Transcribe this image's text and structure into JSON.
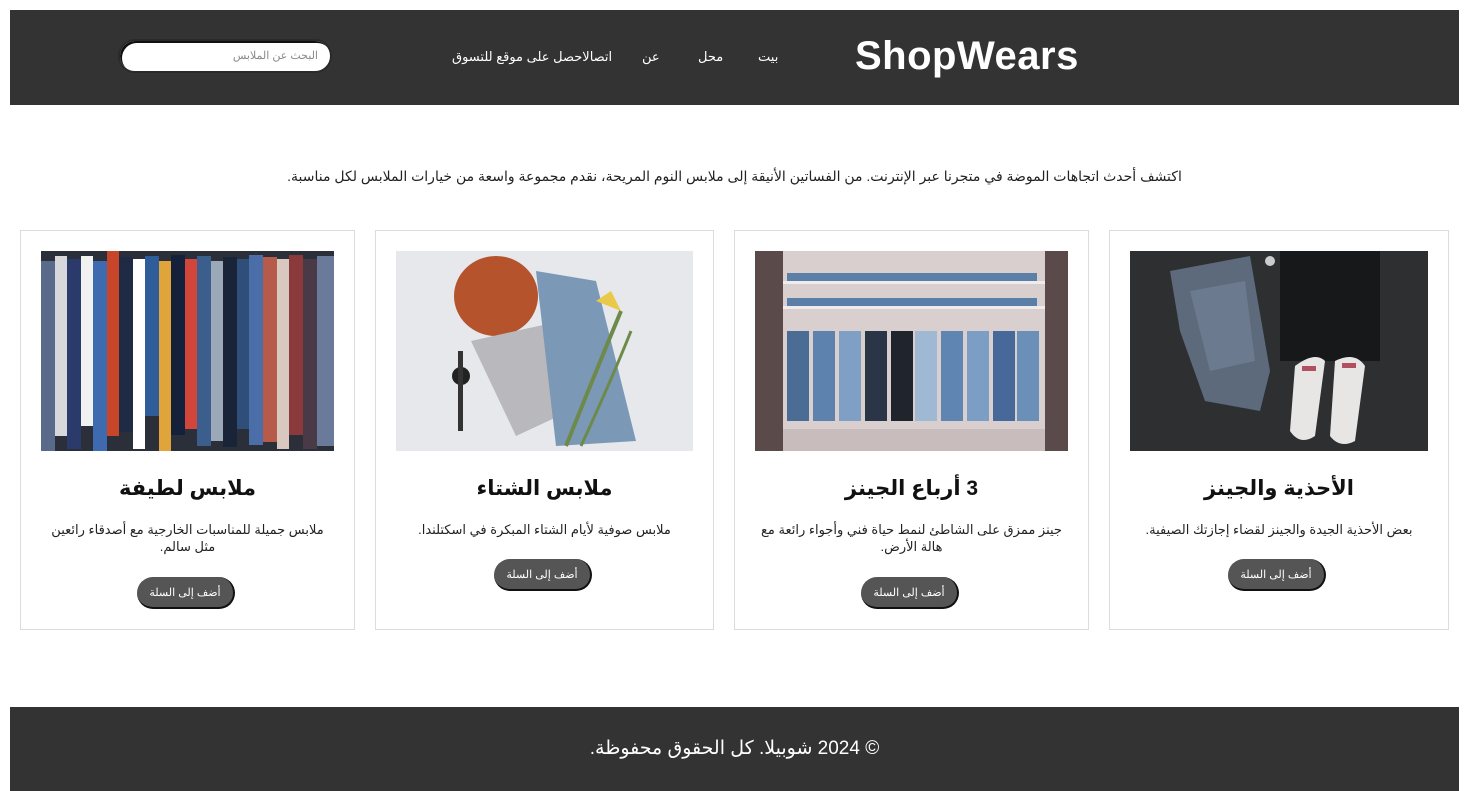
{
  "header": {
    "brand": "ShopWears",
    "nav": {
      "home": "بيت",
      "shop": "محل",
      "about": "عن",
      "contact": "اتصالاحصل على موقع للتسوق"
    },
    "search_placeholder": "البحث عن الملابس"
  },
  "intro": "اكتشف أحدث اتجاهات الموضة في متجرنا عبر الإنترنت. من الفساتين الأنيقة إلى ملابس النوم المريحة، نقدم مجموعة واسعة من خيارات الملابس لكل مناسبة.",
  "cards": [
    {
      "title": "الأحذية والجينز",
      "description": "بعض الأحذية الجيدة والجينز لقضاء إجازتك الصيفية.",
      "button": "أضف إلى السلة",
      "image_icon": "shoes-and-jeans-photo"
    },
    {
      "title": "3 أرباع الجينز",
      "description": "جينز ممزق على الشاطئ لنمط حياة فني وأجواء رائعة مع هالة الأرض.",
      "button": "أضف إلى السلة",
      "image_icon": "jeans-rack-photo"
    },
    {
      "title": "ملابس الشتاء",
      "description": "ملابس صوفية لأيام الشتاء المبكرة في اسكتلندا.",
      "button": "أضف إلى السلة",
      "image_icon": "winter-clothes-photo"
    },
    {
      "title": "ملابس لطيفة",
      "description": "ملابس جميلة للمناسبات الخارجية مع أصدقاء رائعين مثل سالم.",
      "button": "أضف إلى السلة",
      "image_icon": "clothes-rack-photo"
    }
  ],
  "footer": {
    "copyright": "© 2024 شوبيلا. كل الحقوق محفوظة."
  },
  "colors": {
    "header_bg": "#333333",
    "footer_bg": "#333333",
    "button_bg": "#555555"
  }
}
